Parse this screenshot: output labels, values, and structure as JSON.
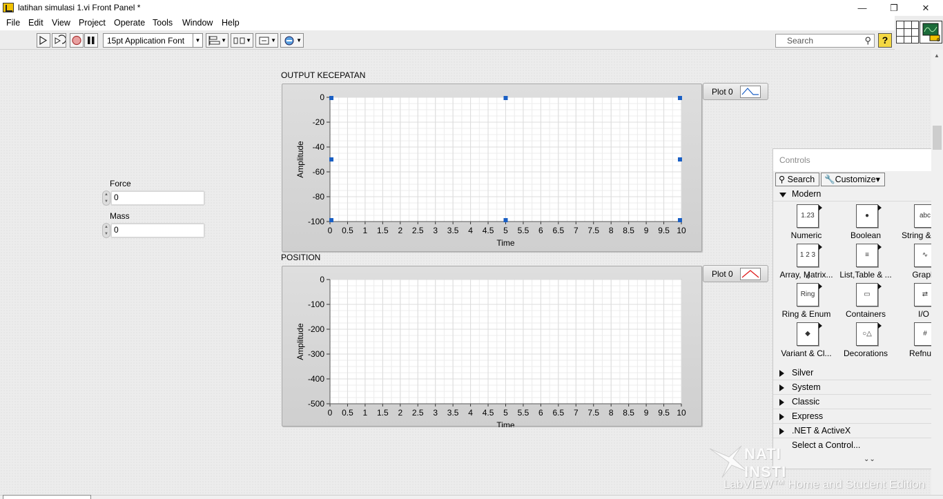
{
  "window": {
    "title": "latihan simulasi 1.vi Front Panel *",
    "min_glyph": "—",
    "max_glyph": "❐",
    "close_glyph": "✕"
  },
  "menu": [
    "File",
    "Edit",
    "View",
    "Project",
    "Operate",
    "Tools",
    "Window",
    "Help"
  ],
  "toolbar": {
    "font": "15pt Application Font",
    "search_placeholder": "Search",
    "help": "?"
  },
  "controls": {
    "force": {
      "label": "Force",
      "value": "0"
    },
    "mass": {
      "label": "Mass",
      "value": "0"
    }
  },
  "graphs": [
    {
      "label": "OUTPUT KECEPATAN",
      "xlabel": "Time",
      "ylabel": "Amplitude",
      "xticks": [
        "0",
        "0.5",
        "1",
        "1.5",
        "2",
        "2.5",
        "3",
        "3.5",
        "4",
        "4.5",
        "5",
        "5.5",
        "6",
        "6.5",
        "7",
        "7.5",
        "8",
        "8.5",
        "9",
        "9.5",
        "10"
      ],
      "yticks": [
        "0",
        "-20",
        "-40",
        "-60",
        "-80",
        "-100"
      ],
      "legend": "Plot 0",
      "legend_glyph": "sine"
    },
    {
      "label": "POSITION",
      "xlabel": "Time",
      "ylabel": "Amplitude",
      "xticks": [
        "0",
        "0.5",
        "1",
        "1.5",
        "2",
        "2.5",
        "3",
        "3.5",
        "4",
        "4.5",
        "5",
        "5.5",
        "6",
        "6.5",
        "7",
        "7.5",
        "8",
        "8.5",
        "9",
        "9.5",
        "10"
      ],
      "yticks": [
        "0",
        "-100",
        "-200",
        "-300",
        "-400",
        "-500"
      ],
      "legend": "Plot 0",
      "legend_glyph": "triangle",
      "legend_color": "#e02020"
    }
  ],
  "palette": {
    "title": "Controls",
    "search": "Search",
    "customize": "Customize▾",
    "open_section": "Modern",
    "items": [
      {
        "label": "Numeric",
        "icon": "numeric-icon",
        "glyph": "1.23"
      },
      {
        "label": "Boolean",
        "icon": "boolean-icon",
        "glyph": "●"
      },
      {
        "label": "String & Pat",
        "icon": "string-path-icon",
        "glyph": "abc"
      },
      {
        "label": "Array, Matrix...",
        "icon": "array-matrix-icon",
        "glyph": "1 2 3 4"
      },
      {
        "label": "List,Table & ...",
        "icon": "list-table-icon",
        "glyph": "≡"
      },
      {
        "label": "Graph",
        "icon": "graph-icon",
        "glyph": "∿"
      },
      {
        "label": "Ring & Enum",
        "icon": "ring-enum-icon",
        "glyph": "Ring"
      },
      {
        "label": "Containers",
        "icon": "containers-icon",
        "glyph": "▭"
      },
      {
        "label": "I/O",
        "icon": "io-icon",
        "glyph": "⇄"
      },
      {
        "label": "Variant & Cl...",
        "icon": "variant-class-icon",
        "glyph": "◆"
      },
      {
        "label": "Decorations",
        "icon": "decorations-icon",
        "glyph": "○△"
      },
      {
        "label": "Refnum",
        "icon": "refnum-icon",
        "glyph": "#"
      }
    ],
    "sections": [
      "Silver",
      "System",
      "Classic",
      "Express",
      ".NET & ActiveX"
    ],
    "select_control": "Select a Control...",
    "more_glyph": "⌄⌄"
  },
  "watermark": {
    "brand": "NATIONAL INSTRUMENTS",
    "edition": "LabVIEW™ Home and Student Edition"
  },
  "colors": {
    "accent_handle": "#1a5fc4",
    "plot_area": "#ffffff",
    "grid_minor": "#ececec",
    "grid_major": "#dcdcdc"
  }
}
